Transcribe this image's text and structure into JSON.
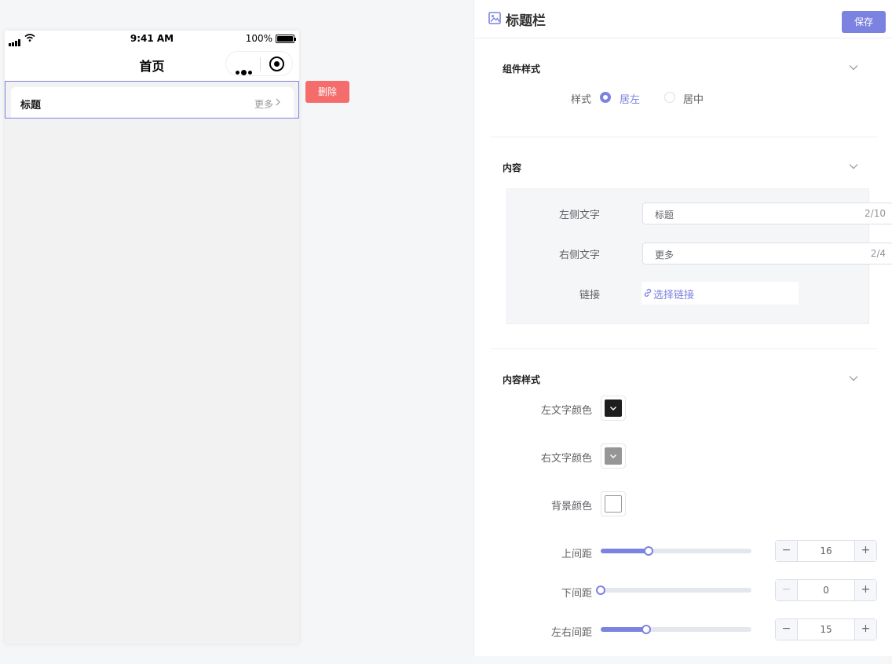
{
  "phone": {
    "status": {
      "time": "9:41 AM",
      "battery": "100%"
    },
    "nav_title": "首页",
    "component": {
      "left_text": "标题",
      "right_text": "更多"
    },
    "delete_label": "删除"
  },
  "panel": {
    "title": "标题栏",
    "save_label": "保存",
    "sections": {
      "style": {
        "title": "组件样式",
        "label": "样式",
        "options": [
          "居左",
          "居中"
        ],
        "selected": "居左"
      },
      "content": {
        "title": "内容",
        "left_label": "左侧文字",
        "left_value": "标题",
        "left_count": "2/10",
        "right_label": "右侧文字",
        "right_value": "更多",
        "right_count": "2/4",
        "link_label": "链接",
        "link_text": "选择链接"
      },
      "content_style": {
        "title": "内容样式",
        "left_color_label": "左文字颜色",
        "left_color": "#1e1e1e",
        "right_color_label": "右文字颜色",
        "right_color": "#969696",
        "bg_color_label": "背景颜色",
        "bg_color": "#ffffff",
        "top_label": "上间距",
        "top_value": 16,
        "bottom_label": "下间距",
        "bottom_value": 0,
        "lr_label": "左右间距",
        "lr_value": 15,
        "slider_max": 50
      }
    }
  },
  "colors": {
    "accent": "#7c82e0",
    "danger": "#f56c6c"
  },
  "icons": [
    "image-icon",
    "chevron-down-icon",
    "chevron-right-icon",
    "link-icon",
    "more-dots-icon",
    "target-icon",
    "wifi-icon",
    "signal-icon",
    "battery-icon"
  ]
}
